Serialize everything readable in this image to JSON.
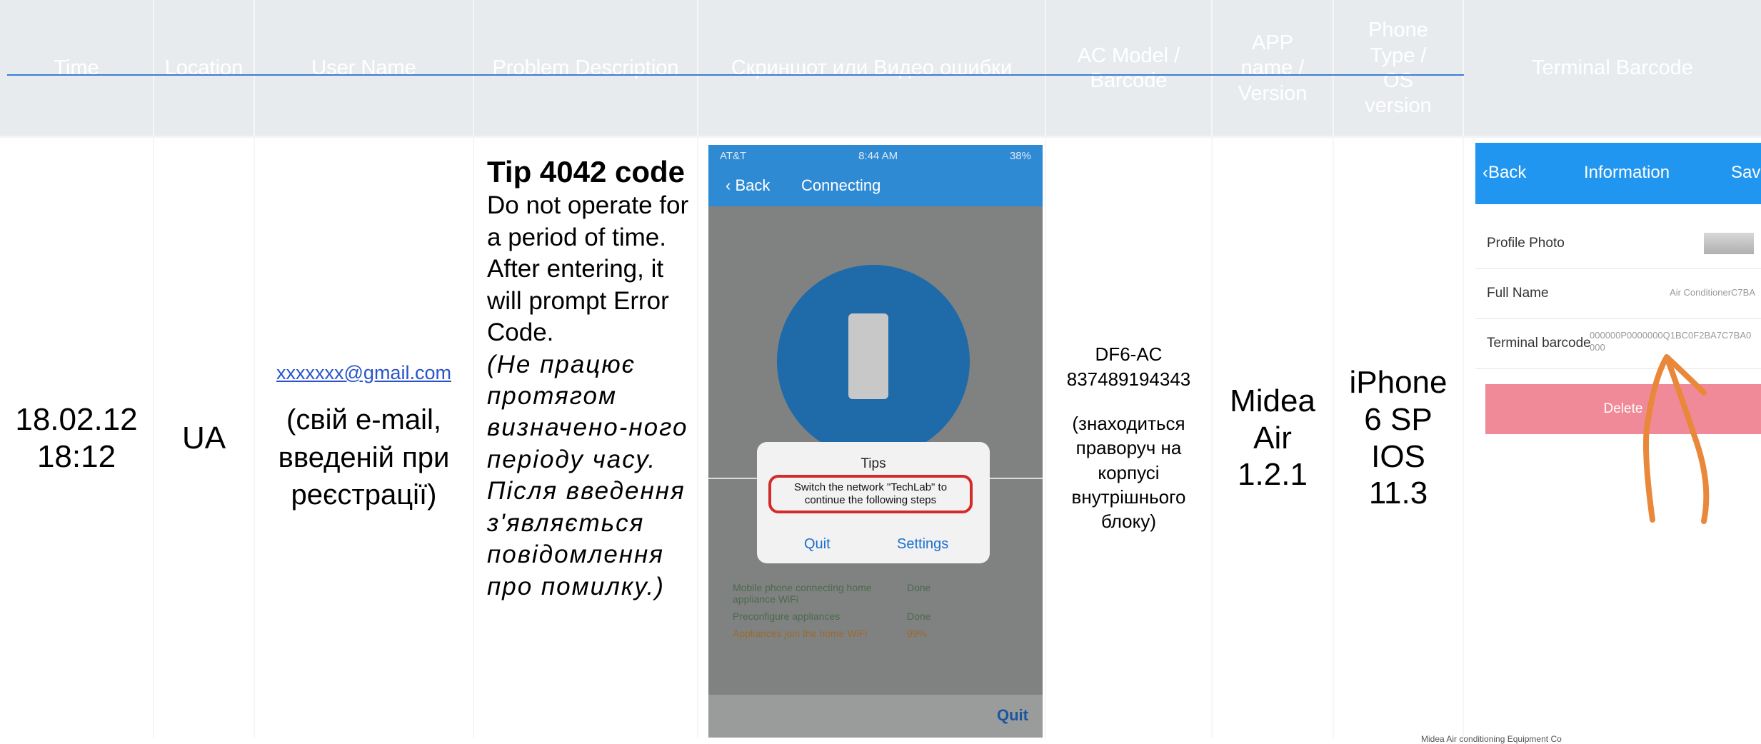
{
  "headers": {
    "time": "Time",
    "location": "Location",
    "user": "User Name",
    "problem": "Problem Description",
    "screenshot": "Скриншот или Видео ошибки",
    "ac": "AC Model / Barcode",
    "app": "APP name / Version",
    "phone": "Phone Type / OS version",
    "terminal": "Terminal Barcode"
  },
  "row": {
    "time_line1": "18.02.12",
    "time_line2": "18:12",
    "location": "UA",
    "user_email": "xxxxxxx@gmail.com",
    "user_note": "(свій e-mail, введеній при реєстрації)",
    "problem_title": "Tip 4042 code",
    "problem_en": "Do not operate for a period of time. After entering, it will prompt Error Code.",
    "problem_ua": "(Не працює протягом визначено-ного періоду часу. Після введення з'являється повідомлення про помилку.)",
    "ac_model": "DF6-AC",
    "ac_barcode": "837489194343",
    "ac_note": "(знаходиться праворуч на корпусі внутрішнього блоку)",
    "app_name": "Midea Air",
    "app_version": "1.2.1",
    "phone_model": "iPhone 6 SP",
    "phone_os": "IOS 11.3"
  },
  "phone_screen": {
    "carrier": "AT&T",
    "time": "8:44 AM",
    "battery": "38%",
    "back": "Back",
    "title": "Connecting",
    "dialog_title": "Tips",
    "dialog_msg": "Switch the network \"TechLab\" to continue the following steps",
    "quit": "Quit",
    "settings": "Settings",
    "steps": [
      {
        "label": "Mobile phone connecting home appliance WiFi",
        "status": "Done"
      },
      {
        "label": "Preconfigure appliances",
        "status": "Done"
      },
      {
        "label": "Appliances join the home WiFi",
        "status": "99%"
      }
    ],
    "bottom_quit": "Quit"
  },
  "terminal_screen": {
    "back": "Back",
    "title": "Information",
    "save": "Save",
    "profile_photo": "Profile Photo",
    "full_name": "Full Name",
    "full_name_value": "Air ConditionerC7BA",
    "terminal_label": "Terminal barcode",
    "terminal_value": "000000P0000000Q1BC0F2BA7C7BA0 000",
    "delete": "Delete"
  },
  "footer": "Midea Air conditioning Equipment Co"
}
